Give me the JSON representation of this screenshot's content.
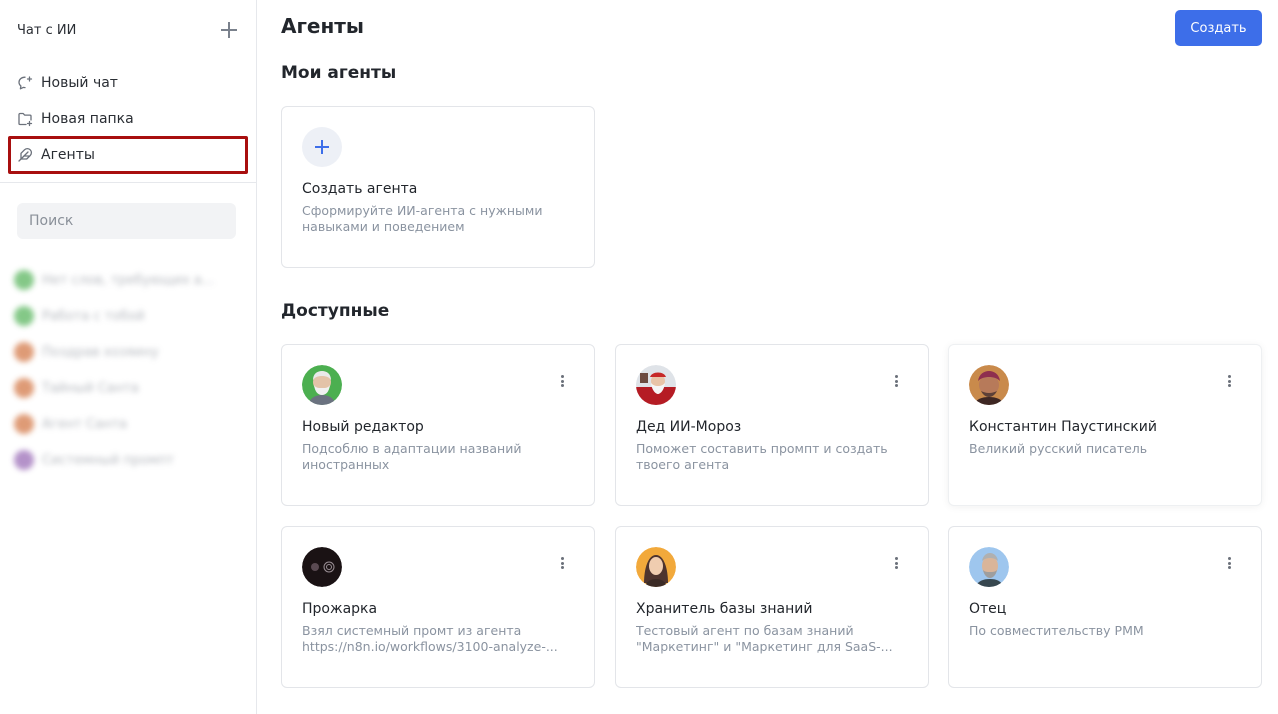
{
  "sidebar": {
    "title": "Чат с ИИ",
    "nav": {
      "new_chat": "Новый чат",
      "new_folder": "Новая папка",
      "agents": "Агенты"
    },
    "search_placeholder": "Поиск",
    "history": [
      {
        "label": "Нет слов, требующих а...",
        "color": "#6fbf73"
      },
      {
        "label": "Работа с тобой",
        "color": "#6fbf73"
      },
      {
        "label": "Поздрав хозяину",
        "color": "#d98a5f"
      },
      {
        "label": "Тайный Санта",
        "color": "#d98a5f"
      },
      {
        "label": "Агент Санта",
        "color": "#d98a5f"
      },
      {
        "label": "Системный промпт",
        "color": "#a77fc0"
      }
    ]
  },
  "header": {
    "title": "Агенты",
    "create_label": "Создать"
  },
  "my_agents": {
    "title": "Мои агенты",
    "create_card": {
      "name": "Создать агента",
      "desc": "Сформируйте ИИ-агента с нужными навыками и поведением"
    }
  },
  "available": {
    "title": "Доступные",
    "agents": [
      {
        "name": "Новый редактор",
        "desc": "Подсоблю в адаптации названий иностранных"
      },
      {
        "name": "Дед ИИ-Мороз",
        "desc": "Поможет составить промпт и создать твоего агента"
      },
      {
        "name": "Константин Паустинский",
        "desc": "Великий русский писатель"
      },
      {
        "name": "Прожарка",
        "desc": "Взял системный промт из агента https://n8n.io/workflows/3100-analyze-..."
      },
      {
        "name": "Хранитель базы знаний",
        "desc": "Тестовый агент по базам знаний \"Маркетинг\" и \"Маркетинг для SaaS-..."
      },
      {
        "name": "Отец",
        "desc": "По совместительству PMM"
      }
    ]
  },
  "colors": {
    "accent": "#3d6ee9",
    "highlight_frame": "#a80f0f"
  }
}
